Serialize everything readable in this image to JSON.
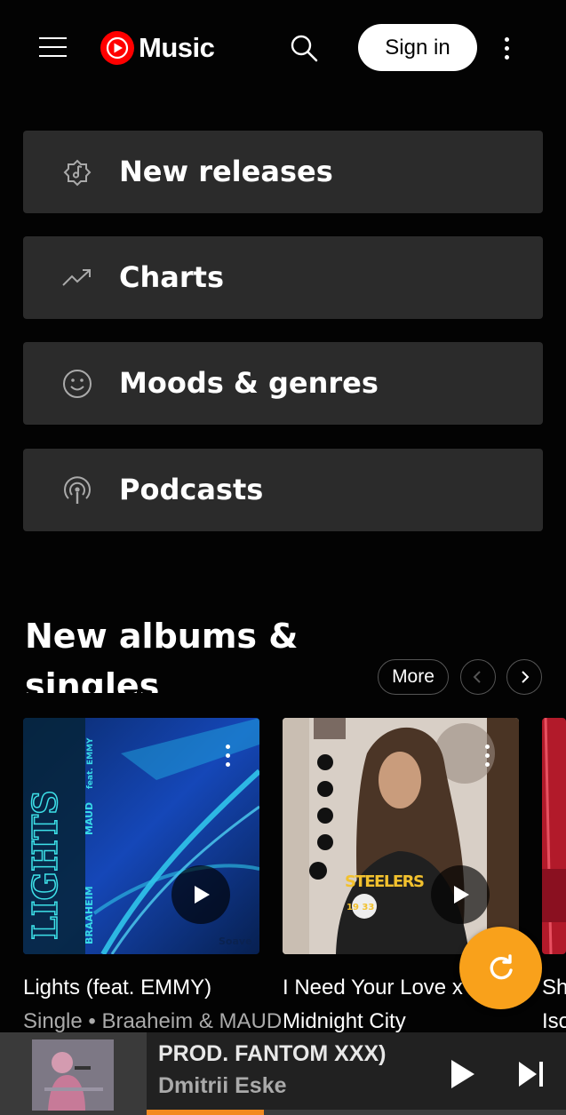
{
  "header": {
    "logo_text": "Music",
    "signin_label": "Sign in",
    "menu_icon": "hamburger-menu-icon",
    "search_icon": "search-icon",
    "more_icon": "more-vert-icon"
  },
  "nav": [
    {
      "label": "New releases",
      "icon": "new-releases-icon"
    },
    {
      "label": "Charts",
      "icon": "trending-up-icon"
    },
    {
      "label": "Moods & genres",
      "icon": "smiley-icon"
    },
    {
      "label": "Podcasts",
      "icon": "podcast-icon"
    }
  ],
  "section": {
    "title": "New albums & singles",
    "more_label": "More"
  },
  "albums": [
    {
      "title": "Lights (feat. EMMY)",
      "subtitle": "Single • Braaheim & MAUD",
      "art_text_main": "LIGHTS",
      "art_text_artist1": "BRAAHEIM",
      "art_text_artist2": "MAUD",
      "art_text_feat": "feat. EMMY",
      "art_label": "Soave"
    },
    {
      "title": "I Need Your Love x",
      "subtitle": "Midnight City",
      "shirt_text": "STEELERS",
      "shirt_numbers": "19 33"
    },
    {
      "title": "Sh",
      "subtitle": "Iso"
    }
  ],
  "player": {
    "title": "PROD. FANTOM XXX)",
    "artist": "Dmitrii Eske",
    "progress": 0.28
  },
  "colors": {
    "background": "#030303",
    "card": "#2b2b2b",
    "accent_red": "#ff0000",
    "fab": "#f9a11b",
    "progress": "#f38a1f"
  }
}
